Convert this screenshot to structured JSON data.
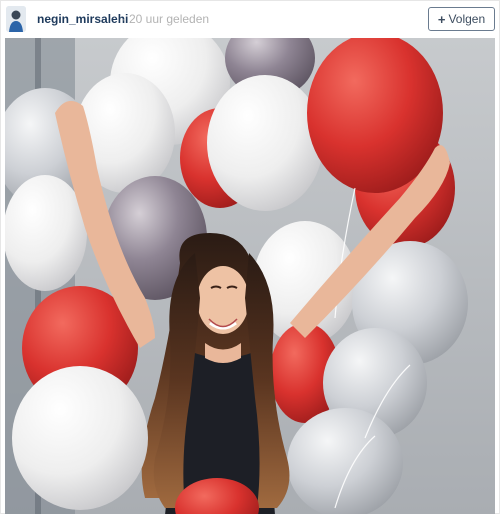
{
  "post": {
    "username": "negin_mirsalehi",
    "separator": "·",
    "timestamp": "20 uur geleden",
    "follow_button": {
      "plus": "+",
      "label": "Volgen"
    }
  },
  "icons": {
    "avatar": "profile-picture",
    "follow": "plus-icon"
  },
  "colors": {
    "username": "#1e3a5c",
    "timestamp": "#b3b3b3",
    "follow_border": "#6a7b8f",
    "balloon_red": "#d9322e",
    "balloon_white": "#f2f2f2",
    "balloon_silver": "#c9ccd1",
    "balloon_purple": "#8b8190",
    "background_wall": "#bfc3c8"
  }
}
